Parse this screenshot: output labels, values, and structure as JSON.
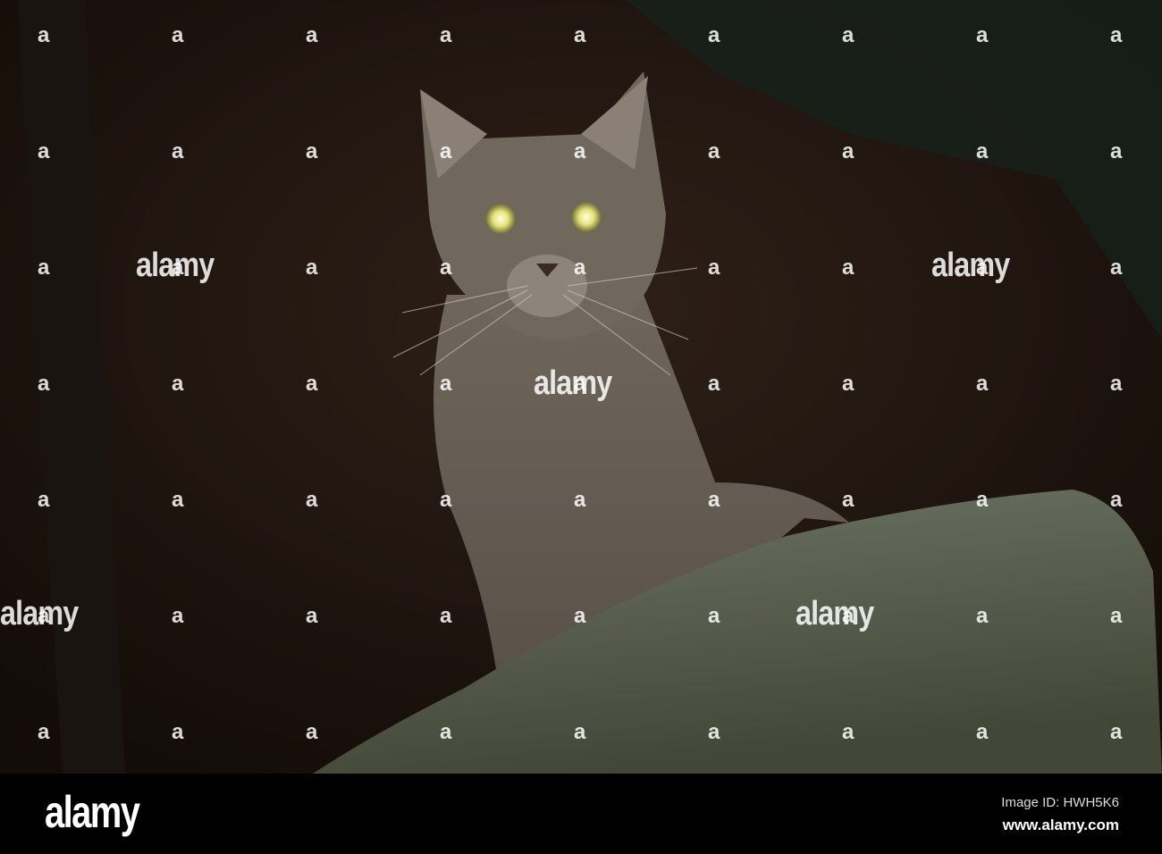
{
  "watermark": {
    "text": "alamy",
    "letter": "a"
  },
  "footer": {
    "logo": "alamy",
    "image_id": "Image ID: HWH5K6",
    "url": "www.alamy.com"
  },
  "colors": {
    "background": "#1c120d",
    "eye_glow": "#f2f0a0",
    "rock": "#5a5f52",
    "fur": "#6b6157"
  }
}
